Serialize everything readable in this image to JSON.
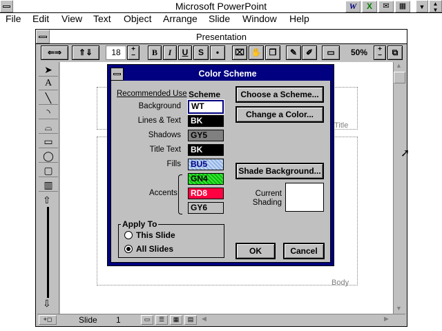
{
  "app": {
    "title": "Microsoft PowerPoint",
    "system_menu_icon": "system-menu-icon",
    "tray_icons": [
      "word-icon",
      "excel-icon",
      "mail-icon",
      "project-icon"
    ]
  },
  "menubar": {
    "items": [
      "File",
      "Edit",
      "View",
      "Text",
      "Object",
      "Arrange",
      "Slide",
      "Window",
      "Help"
    ]
  },
  "document": {
    "title": "Presentation"
  },
  "toolbar": {
    "font_size": "18",
    "bold": "B",
    "italic": "I",
    "underline": "U",
    "shadow": "S",
    "bullet": "•",
    "zoom": "50%"
  },
  "slide": {
    "title_placeholder": "Title",
    "body_placeholder": "Body"
  },
  "statusbar": {
    "slide_label": "Slide",
    "slide_number": "1"
  },
  "dialog": {
    "title": "Color Scheme",
    "recommended_use_header": "Recommended Use",
    "scheme_header": "Scheme",
    "rows": [
      {
        "label": "Background",
        "value": "WT",
        "color": "#ffffff",
        "text_color": "#000000"
      },
      {
        "label": "Lines & Text",
        "value": "BK",
        "color": "#000000",
        "text_color": "#ffffff"
      },
      {
        "label": "Shadows",
        "value": "GY5",
        "color": "#808080",
        "text_color": "#000000"
      },
      {
        "label": "Title Text",
        "value": "BK",
        "color": "#000000",
        "text_color": "#ffffff"
      },
      {
        "label": "Fills",
        "value": "BU5",
        "color": "#8fb3e8",
        "text_color": "#000080"
      }
    ],
    "accents_label": "Accents",
    "accents": [
      {
        "value": "GN4",
        "color": "#00c000",
        "text_color": "#000000"
      },
      {
        "value": "RD8",
        "color": "#ff0040",
        "text_color": "#ffffff"
      },
      {
        "value": "GY6",
        "color": "#c0c0c0",
        "text_color": "#000000"
      }
    ],
    "choose_scheme_button": "Choose a Scheme...",
    "change_color_button": "Change a Color...",
    "shade_background_button": "Shade Background...",
    "current_shading_label": "Current\nShading",
    "apply_to_label": "Apply To",
    "this_slide_label": "This Slide",
    "all_slides_label": "All Slides",
    "selected_apply": "All Slides",
    "ok_button": "OK",
    "cancel_button": "Cancel",
    "title_bar_color": "#000080"
  }
}
